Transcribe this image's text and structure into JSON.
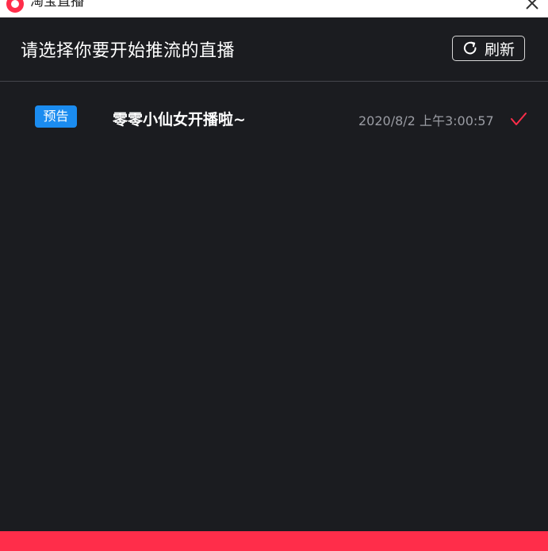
{
  "window": {
    "app_title": "淘宝直播",
    "logo_icon": "taobao-live-logo",
    "close_icon": "close-icon"
  },
  "header": {
    "title": "请选择你要开始推流的直播",
    "refresh_label": "刷新",
    "refresh_icon": "refresh-icon"
  },
  "streams": [
    {
      "badge": "预告",
      "title": "零零小仙女开播啦~",
      "time": "2020/8/2 上午3:00:57",
      "selected": true
    }
  ],
  "colors": {
    "background": "#1b1c20",
    "accent": "#ff2d4a",
    "badge": "#1b8cf0",
    "check": "#ff2d4a"
  }
}
